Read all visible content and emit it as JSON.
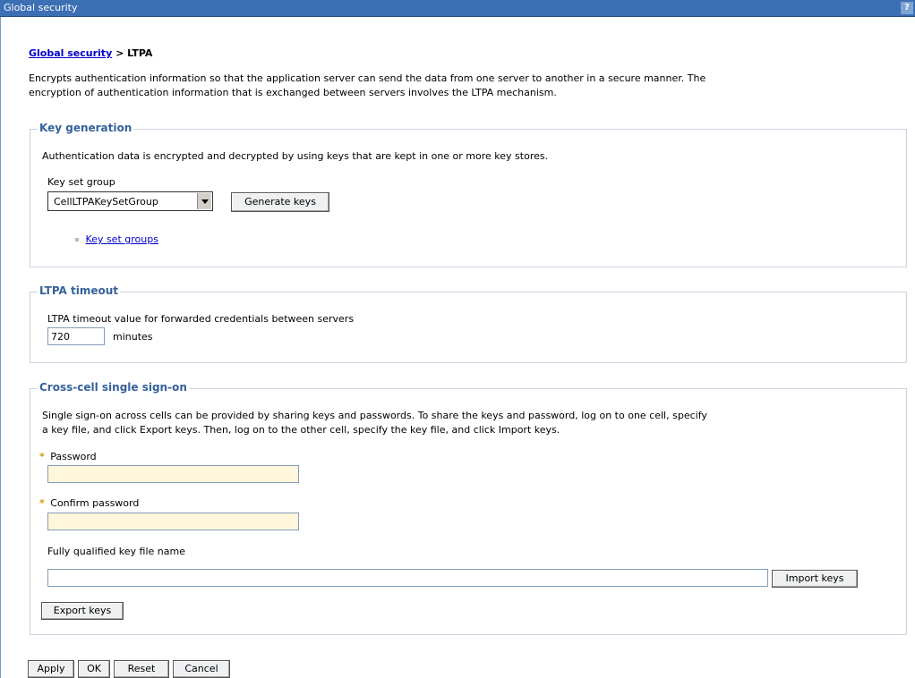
{
  "window": {
    "title": "Global security",
    "help_label": "?"
  },
  "breadcrumb": {
    "parent": "Global security",
    "separator": ">",
    "current": "LTPA"
  },
  "description": {
    "line1": "Encrypts authentication information so that the application server can send the data from one server to another in a secure manner. The",
    "line2": "encryption of authentication information that is exchanged between servers involves the LTPA mechanism."
  },
  "key_generation": {
    "legend": "Key generation",
    "text": "Authentication data is encrypted and decrypted by using keys that are kept in one or more key stores.",
    "key_set_group_label": "Key set group",
    "key_set_group_value": "CellLTPAKeySetGroup",
    "generate_button": "Generate keys",
    "link": "Key set groups"
  },
  "ltpa_timeout": {
    "legend": "LTPA timeout",
    "label": "LTPA timeout value for forwarded credentials between servers",
    "value": "720",
    "unit": "minutes"
  },
  "cross_cell": {
    "legend": "Cross-cell single sign-on",
    "text_line1": "Single sign-on across cells can be provided by sharing keys and passwords. To share the keys and password, log on to one cell, specify",
    "text_line2": "a key file, and click Export keys. Then, log on to the other cell, specify the key file, and click Import keys.",
    "required_marker": "*",
    "password_label": "Password",
    "password_value": "",
    "confirm_label": "Confirm password",
    "confirm_value": "",
    "key_file_label": "Fully qualified key file name",
    "key_file_value": "",
    "import_button": "Import keys",
    "export_button": "Export keys"
  },
  "actions": {
    "apply": "Apply",
    "ok": "OK",
    "reset": "Reset",
    "cancel": "Cancel"
  },
  "colors": {
    "titlebar": "#3c6fb4",
    "legend": "#35629a",
    "required_bg": "#fff6dc",
    "link": "#0000cc"
  }
}
